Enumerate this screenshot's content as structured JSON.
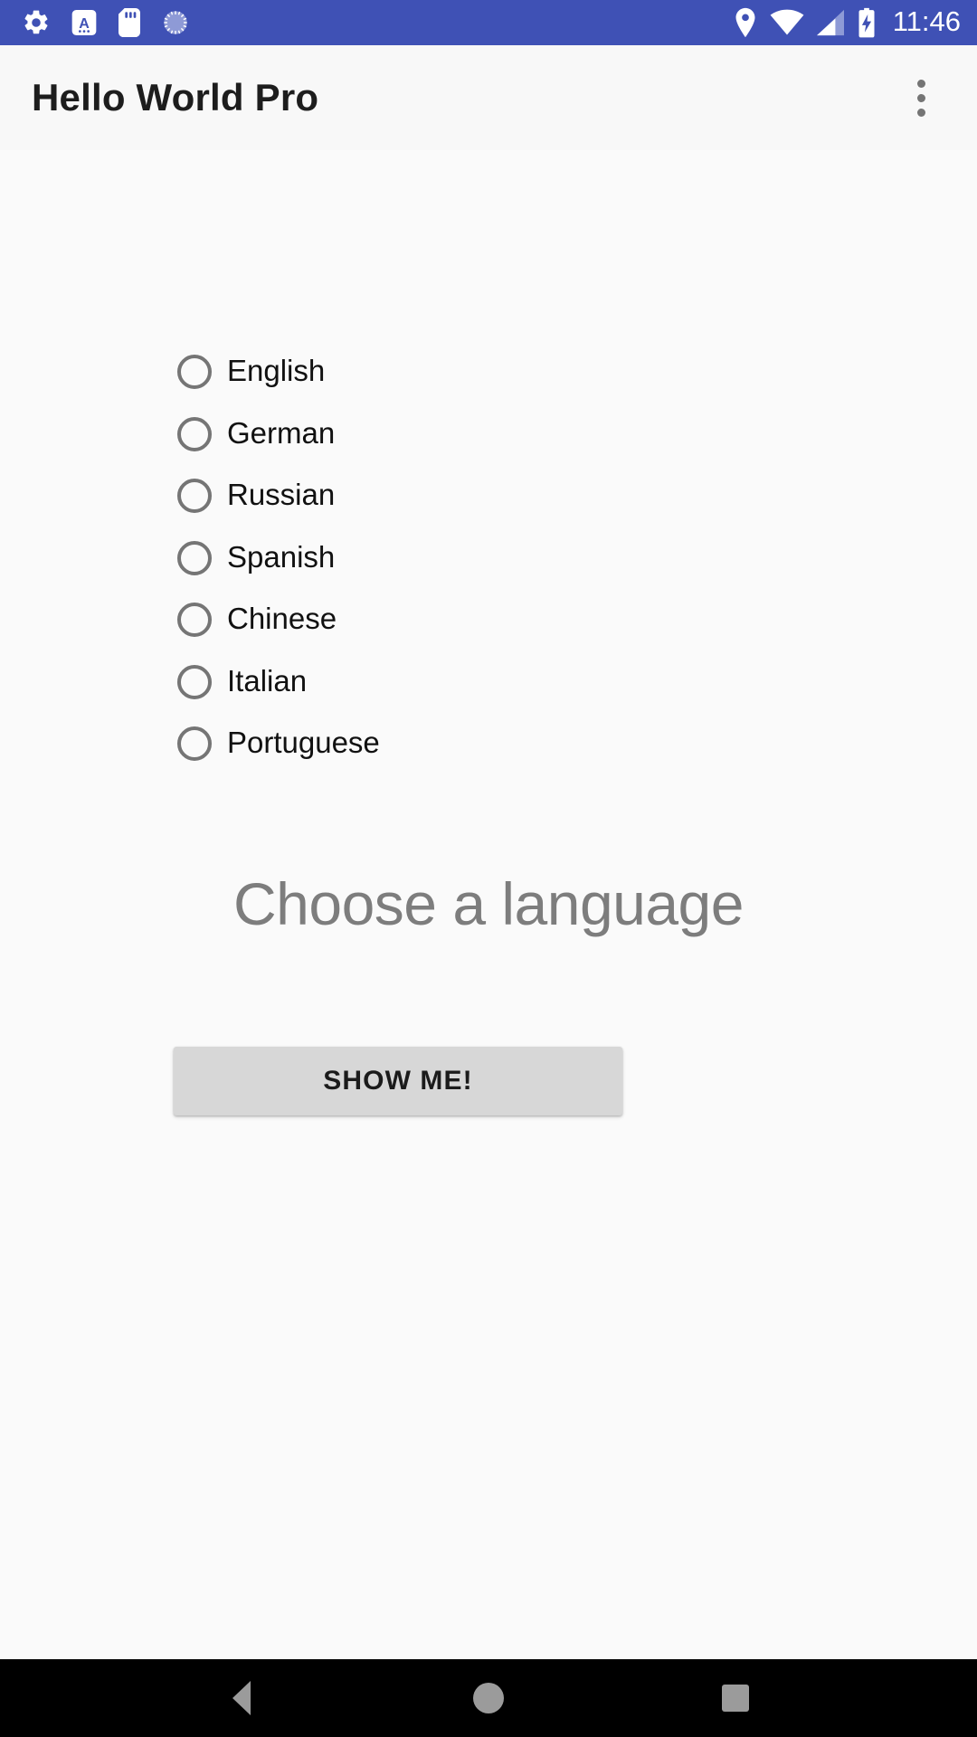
{
  "status_bar": {
    "background_color": "#3f51b5",
    "clock": "11:46",
    "left_icons": [
      {
        "name": "settings-gear-icon"
      },
      {
        "name": "adb-letter-a-icon"
      },
      {
        "name": "sd-card-icon"
      },
      {
        "name": "sync-spinner-icon"
      }
    ],
    "right_icons": [
      {
        "name": "location-pin-icon"
      },
      {
        "name": "wifi-icon"
      },
      {
        "name": "cellular-signal-icon"
      },
      {
        "name": "battery-charging-icon"
      }
    ]
  },
  "app_bar": {
    "title": "Hello World Pro",
    "overflow_menu": "more-options"
  },
  "main": {
    "radio_group": {
      "selected": null,
      "options": [
        {
          "label": "English",
          "checked": false
        },
        {
          "label": "German",
          "checked": false
        },
        {
          "label": "Russian",
          "checked": false
        },
        {
          "label": "Spanish",
          "checked": false
        },
        {
          "label": "Chinese",
          "checked": false
        },
        {
          "label": "Italian",
          "checked": false
        },
        {
          "label": "Portuguese",
          "checked": false
        }
      ]
    },
    "prompt_text": "Choose a language",
    "prompt_color": "#7d7d7d",
    "show_button": {
      "label": "SHOW ME!",
      "background_color": "#d7d7d7",
      "text_color": "#1b1b1b"
    }
  },
  "nav_bar": {
    "background_color": "#000000",
    "buttons": [
      {
        "name": "back"
      },
      {
        "name": "home"
      },
      {
        "name": "recents"
      }
    ]
  }
}
